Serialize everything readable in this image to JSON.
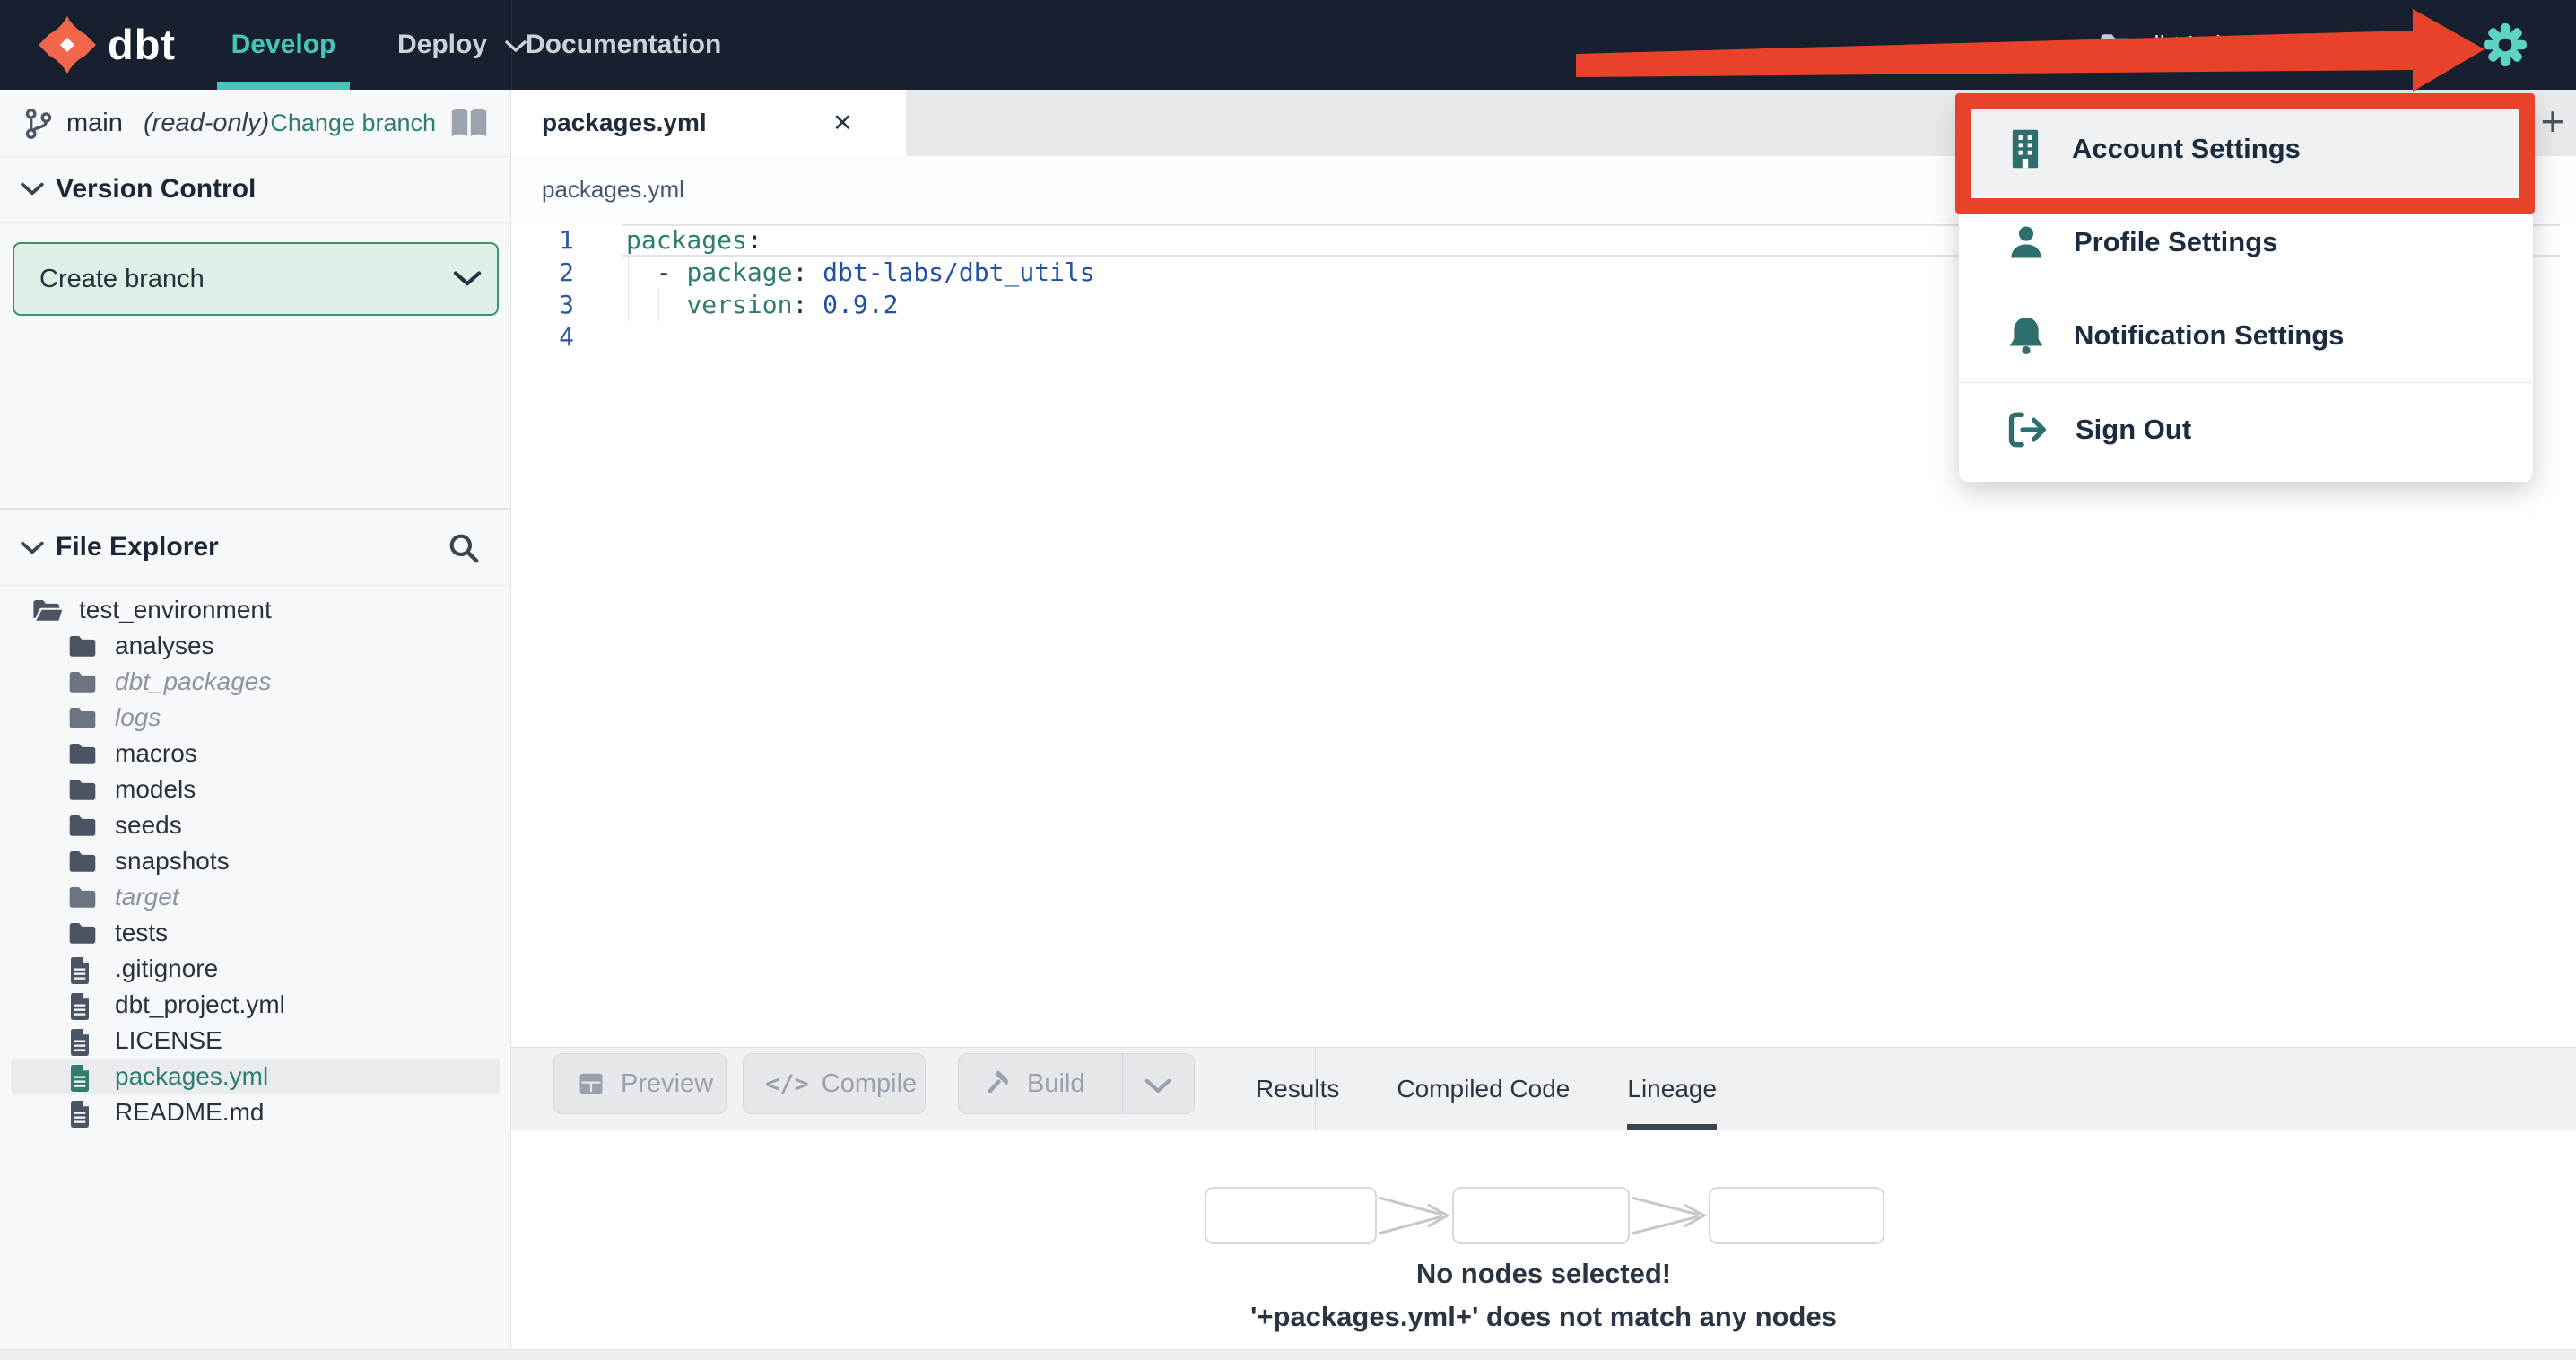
{
  "navbar": {
    "brand": "dbt",
    "tabs": [
      {
        "label": "Develop"
      },
      {
        "label": "Deploy"
      },
      {
        "label": "Documentation"
      }
    ],
    "account_breadcrumb": "dbt Labs / Analytics",
    "help_glyph": "?"
  },
  "user_menu": {
    "items": [
      {
        "label": "Account Settings"
      },
      {
        "label": "Profile Settings"
      },
      {
        "label": "Notification Settings"
      },
      {
        "label": "Sign Out"
      }
    ]
  },
  "sidebar": {
    "branch": {
      "name": "main",
      "mode": "(read-only)",
      "change_label": "Change branch"
    },
    "version_control": {
      "title": "Version Control",
      "create_branch_label": "Create branch"
    },
    "file_explorer": {
      "title": "File Explorer",
      "items": [
        {
          "label": "test_environment"
        },
        {
          "label": "analyses"
        },
        {
          "label": "dbt_packages"
        },
        {
          "label": "logs"
        },
        {
          "label": "macros"
        },
        {
          "label": "models"
        },
        {
          "label": "seeds"
        },
        {
          "label": "snapshots"
        },
        {
          "label": "target"
        },
        {
          "label": "tests"
        },
        {
          "label": ".gitignore"
        },
        {
          "label": "dbt_project.yml"
        },
        {
          "label": "LICENSE"
        },
        {
          "label": "packages.yml"
        },
        {
          "label": "README.md"
        }
      ]
    }
  },
  "editor": {
    "tab": "packages.yml",
    "close_glyph": "✕",
    "new_tab_glyph": "+",
    "breadcrumb": "packages.yml",
    "gutter": [
      "1",
      "2",
      "3",
      "4"
    ],
    "lines": {
      "l1": [
        {
          "t": "packages"
        },
        {
          "t": ":"
        }
      ],
      "l2": [
        {
          "t": "  - "
        },
        {
          "t": "package"
        },
        {
          "t": ": "
        },
        {
          "t": "dbt-labs/dbt_utils"
        }
      ],
      "l3": [
        {
          "t": "    "
        },
        {
          "t": "version"
        },
        {
          "t": ": "
        },
        {
          "t": "0.9.2"
        }
      ]
    }
  },
  "bottom": {
    "preview_label": "Preview",
    "compile_label": "Compile",
    "compile_glyph": "</>",
    "build_label": "Build",
    "tabs": [
      {
        "label": "Results"
      },
      {
        "label": "Compiled Code"
      },
      {
        "label": "Lineage"
      }
    ],
    "lineage_message_title": "No nodes selected!",
    "lineage_message_detail": "'+packages.yml+' does not match any nodes"
  },
  "colors": {
    "navbar_bg": "#16202e",
    "accent_teal": "#45c6bb",
    "gear_teal": "#5cd3c5",
    "menu_icon_teal": "#2e6f6e",
    "annotation_red": "#e8432a",
    "create_branch_green_bg": "#def0e5",
    "create_branch_green_border": "#3e9168",
    "code_key": "#2e7d6f",
    "code_value": "#2150a4",
    "link_teal": "#2f7d6f"
  }
}
